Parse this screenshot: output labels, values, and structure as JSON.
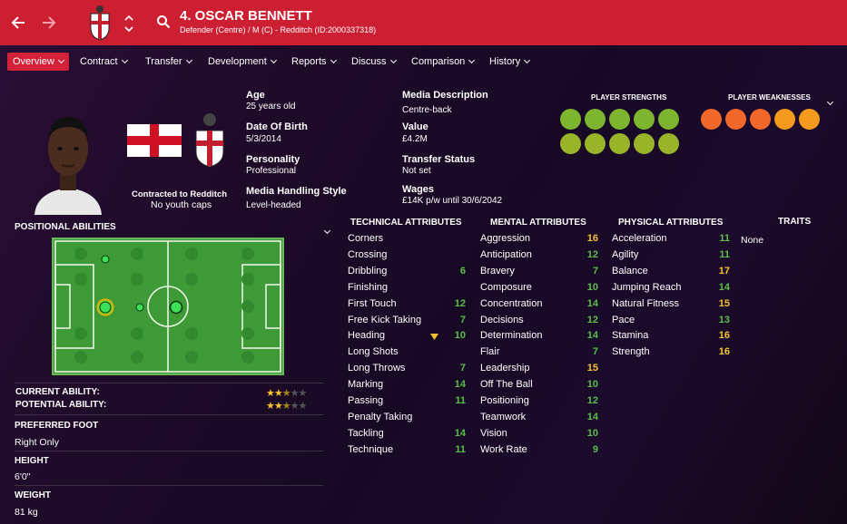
{
  "header": {
    "title": "4. OSCAR BENNETT",
    "subtitle": "Defender (Centre) / M (C) - Redditch (ID:2000337318)"
  },
  "nav": [
    "Overview",
    "Contract",
    "Transfer",
    "Development",
    "Reports",
    "Discuss",
    "Comparison",
    "History"
  ],
  "profile": {
    "contract_line": "Contracted to Redditch",
    "youth_line": "No youth caps"
  },
  "info_left": [
    {
      "label": "Age",
      "value": "25 years old"
    },
    {
      "label": "Date Of Birth",
      "value": "5/3/2014"
    },
    {
      "label": "Personality",
      "value": "Professional"
    },
    {
      "label": "Media Handling Style",
      "value": "Level-headed"
    }
  ],
  "info_right": [
    {
      "label": "Media Description",
      "value": "Centre-back"
    },
    {
      "label": "Value",
      "value": "£4.2M"
    },
    {
      "label": "Transfer Status",
      "value": "Not set"
    },
    {
      "label": "Wages",
      "value": "£14K p/w until 30/6/2042"
    }
  ],
  "strengths": {
    "title": "PLAYER STRENGTHS",
    "icons": [
      "head-icon",
      "cone-icon",
      "target-icon",
      "stopwatch-icon",
      "star-icon",
      "chart-up-icon",
      "bandage-icon",
      "handshake-icon",
      "pitch-icon",
      "clipboard-icon"
    ]
  },
  "weaknesses": {
    "title": "PLAYER WEAKNESSES",
    "icons": [
      "ball-warning-icon",
      "plus-icon",
      "boot-icon",
      "shield-chevron-icon",
      "flask-icon"
    ]
  },
  "positional": {
    "title": "POSITIONAL ABILITIES"
  },
  "ability": {
    "current_label": "CURRENT ABILITY:",
    "potential_label": "POTENTIAL ABILITY:",
    "current_stars": 2.5,
    "potential_stars": 2.5
  },
  "details": [
    {
      "label": "PREFERRED FOOT",
      "value": "Right Only"
    },
    {
      "label": "HEIGHT",
      "value": "6'0\""
    },
    {
      "label": "WEIGHT",
      "value": "81 kg"
    }
  ],
  "technical": {
    "title": "TECHNICAL ATTRIBUTES",
    "rows": [
      {
        "name": "Corners",
        "value": ""
      },
      {
        "name": "Crossing",
        "value": ""
      },
      {
        "name": "Dribbling",
        "value": "6"
      },
      {
        "name": "Finishing",
        "value": ""
      },
      {
        "name": "First Touch",
        "value": "12"
      },
      {
        "name": "Free Kick Taking",
        "value": "7"
      },
      {
        "name": "Heading",
        "value": "10"
      },
      {
        "name": "Long Shots",
        "value": ""
      },
      {
        "name": "Long Throws",
        "value": "7"
      },
      {
        "name": "Marking",
        "value": "14"
      },
      {
        "name": "Passing",
        "value": "11"
      },
      {
        "name": "Penalty Taking",
        "value": ""
      },
      {
        "name": "Tackling",
        "value": "14"
      },
      {
        "name": "Technique",
        "value": "11"
      }
    ]
  },
  "mental": {
    "title": "MENTAL ATTRIBUTES",
    "rows": [
      {
        "name": "Aggression",
        "value": "16"
      },
      {
        "name": "Anticipation",
        "value": "12"
      },
      {
        "name": "Bravery",
        "value": "7"
      },
      {
        "name": "Composure",
        "value": "10"
      },
      {
        "name": "Concentration",
        "value": "14"
      },
      {
        "name": "Decisions",
        "value": "12"
      },
      {
        "name": "Determination",
        "value": "14"
      },
      {
        "name": "Flair",
        "value": "7"
      },
      {
        "name": "Leadership",
        "value": "15"
      },
      {
        "name": "Off The Ball",
        "value": "10"
      },
      {
        "name": "Positioning",
        "value": "12"
      },
      {
        "name": "Teamwork",
        "value": "14"
      },
      {
        "name": "Vision",
        "value": "10"
      },
      {
        "name": "Work Rate",
        "value": "9"
      }
    ]
  },
  "physical": {
    "title": "PHYSICAL ATTRIBUTES",
    "rows": [
      {
        "name": "Acceleration",
        "value": "11"
      },
      {
        "name": "Agility",
        "value": "11"
      },
      {
        "name": "Balance",
        "value": "17"
      },
      {
        "name": "Jumping Reach",
        "value": "14"
      },
      {
        "name": "Natural Fitness",
        "value": "15"
      },
      {
        "name": "Pace",
        "value": "13"
      },
      {
        "name": "Stamina",
        "value": "16"
      },
      {
        "name": "Strength",
        "value": "16"
      }
    ]
  },
  "traits": {
    "title": "TRAITS",
    "value": "None"
  },
  "colors": {
    "header": "#cc1f31",
    "green": "#5bbf4a",
    "yellow": "#f6c232",
    "orange": "#f39a1f",
    "pitch": "#3d9a37"
  }
}
